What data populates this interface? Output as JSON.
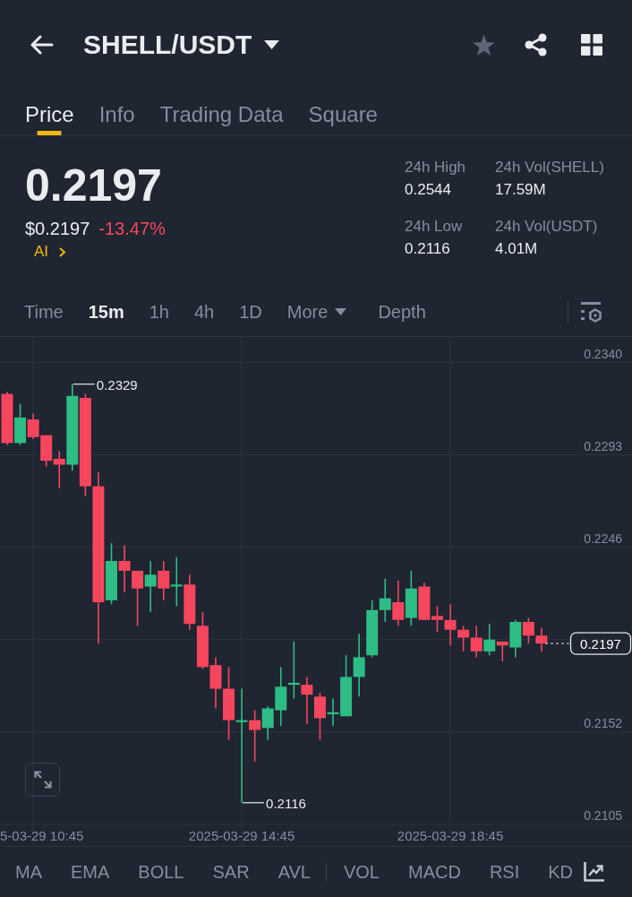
{
  "header": {
    "pair": "SHELL/USDT",
    "favorite": false
  },
  "tabs": [
    {
      "label": "Price",
      "selected": true
    },
    {
      "label": "Info",
      "selected": false
    },
    {
      "label": "Trading Data",
      "selected": false
    },
    {
      "label": "Square",
      "selected": false
    }
  ],
  "ticker": {
    "price": "0.2197",
    "usd_price": "$0.2197",
    "change": "-13.47%",
    "declining": true,
    "ai": "AI"
  },
  "stats": [
    {
      "label": "24h High",
      "value": "0.2544"
    },
    {
      "label": "24h Vol(SHELL)",
      "value": "17.59M"
    },
    {
      "label": "24h Low",
      "value": "0.2116"
    },
    {
      "label": "24h Vol(USDT)",
      "value": "4.01M"
    }
  ],
  "intervals": [
    {
      "label": "Time",
      "kind": "interval",
      "selected": false
    },
    {
      "label": "15m",
      "kind": "interval",
      "selected": true
    },
    {
      "label": "1h",
      "kind": "interval",
      "selected": false
    },
    {
      "label": "4h",
      "kind": "interval",
      "selected": false
    },
    {
      "label": "1D",
      "kind": "interval",
      "selected": false
    },
    {
      "label": "More",
      "kind": "menu",
      "selected": false
    },
    {
      "label": "Depth",
      "kind": "view",
      "selected": false
    }
  ],
  "chart": {
    "chart_data": {
      "type": "candlestick",
      "categories": [
        null,
        null,
        "5-03-29 10:45",
        null,
        null,
        null,
        null,
        null,
        null,
        null,
        null,
        null,
        null,
        null,
        null,
        null,
        null,
        null,
        "2025-03-29 14:45",
        null,
        null,
        null,
        null,
        null,
        null,
        null,
        null,
        null,
        null,
        null,
        null,
        null,
        null,
        null,
        "2025-03-29 18:45",
        null,
        null,
        null,
        null,
        null,
        null,
        null
      ],
      "ohlc": [
        [
          0.2324,
          0.2325,
          0.2298,
          0.2299
        ],
        [
          0.2299,
          0.2319,
          0.2298,
          0.2312
        ],
        [
          0.2311,
          0.2314,
          0.2301,
          0.2302
        ],
        [
          0.2303,
          0.2303,
          0.2287,
          0.229
        ],
        [
          0.2291,
          0.2295,
          0.2276,
          0.2288
        ],
        [
          0.2288,
          0.2329,
          0.2285,
          0.2323
        ],
        [
          0.2322,
          0.2324,
          0.2272,
          0.2277
        ],
        [
          0.2277,
          0.2284,
          0.2197,
          0.2218
        ],
        [
          0.2219,
          0.2248,
          0.2217,
          0.2239
        ],
        [
          0.2239,
          0.2247,
          0.2223,
          0.2234
        ],
        [
          0.2234,
          0.2234,
          0.2206,
          0.2225
        ],
        [
          0.2226,
          0.2239,
          0.2213,
          0.2232
        ],
        [
          0.2234,
          0.2239,
          0.2219,
          0.2225
        ],
        [
          0.2226,
          0.2241,
          0.2216,
          0.2227
        ],
        [
          0.2227,
          0.2232,
          0.2204,
          0.2207
        ],
        [
          0.2206,
          0.2213,
          0.2184,
          0.2185
        ],
        [
          0.2186,
          0.219,
          0.2164,
          0.2174
        ],
        [
          0.2174,
          0.2185,
          0.2148,
          0.2158
        ],
        [
          0.2157,
          0.2174,
          0.2116,
          0.2158
        ],
        [
          0.2158,
          0.2163,
          0.2137,
          0.2153
        ],
        [
          0.2154,
          0.2165,
          0.2148,
          0.2164
        ],
        [
          0.2163,
          0.2185,
          0.2155,
          0.2175
        ],
        [
          0.2176,
          0.2198,
          0.2169,
          0.2177
        ],
        [
          0.2176,
          0.218,
          0.2156,
          0.2171
        ],
        [
          0.217,
          0.2172,
          0.2148,
          0.2159
        ],
        [
          0.2161,
          0.2169,
          0.2155,
          0.2162
        ],
        [
          0.216,
          0.2191,
          0.216,
          0.218
        ],
        [
          0.218,
          0.2202,
          0.217,
          0.219
        ],
        [
          0.2191,
          0.2219,
          0.219,
          0.2214
        ],
        [
          0.2214,
          0.223,
          0.2208,
          0.222
        ],
        [
          0.2218,
          0.2229,
          0.2206,
          0.2209
        ],
        [
          0.221,
          0.2234,
          0.2206,
          0.2225
        ],
        [
          0.2226,
          0.2228,
          0.2209,
          0.2209
        ],
        [
          0.2211,
          0.2216,
          0.2203,
          0.2209
        ],
        [
          0.2209,
          0.2217,
          0.2196,
          0.2204
        ],
        [
          0.2204,
          0.2206,
          0.2193,
          0.22
        ],
        [
          0.22,
          0.2206,
          0.219,
          0.2193
        ],
        [
          0.2193,
          0.2207,
          0.2191,
          0.2199
        ],
        [
          0.2198,
          0.2198,
          0.2188,
          0.2196
        ],
        [
          0.2195,
          0.2209,
          0.219,
          0.2208
        ],
        [
          0.2208,
          0.221,
          0.2197,
          0.2201
        ],
        [
          0.2201,
          0.2205,
          0.2193,
          0.2197
        ]
      ],
      "ylim": [
        0.2094,
        0.2353
      ],
      "yticks": [
        {
          "value": 0.234,
          "label": "0.2340"
        },
        {
          "value": 0.2293,
          "label": "0.2293"
        },
        {
          "value": 0.2246,
          "label": "0.2246"
        },
        {
          "value": 0.2152,
          "label": "0.2152"
        },
        {
          "value": 0.2105,
          "label": "0.2105"
        }
      ],
      "grid": true,
      "annotations": [
        "0.2329",
        "0.2116"
      ]
    },
    "last_price_tag": "0.2197"
  },
  "indicators": {
    "main": [
      "MA",
      "EMA",
      "BOLL",
      "SAR",
      "AVL"
    ],
    "sub": [
      "VOL",
      "MACD",
      "RSI",
      "KD"
    ]
  }
}
